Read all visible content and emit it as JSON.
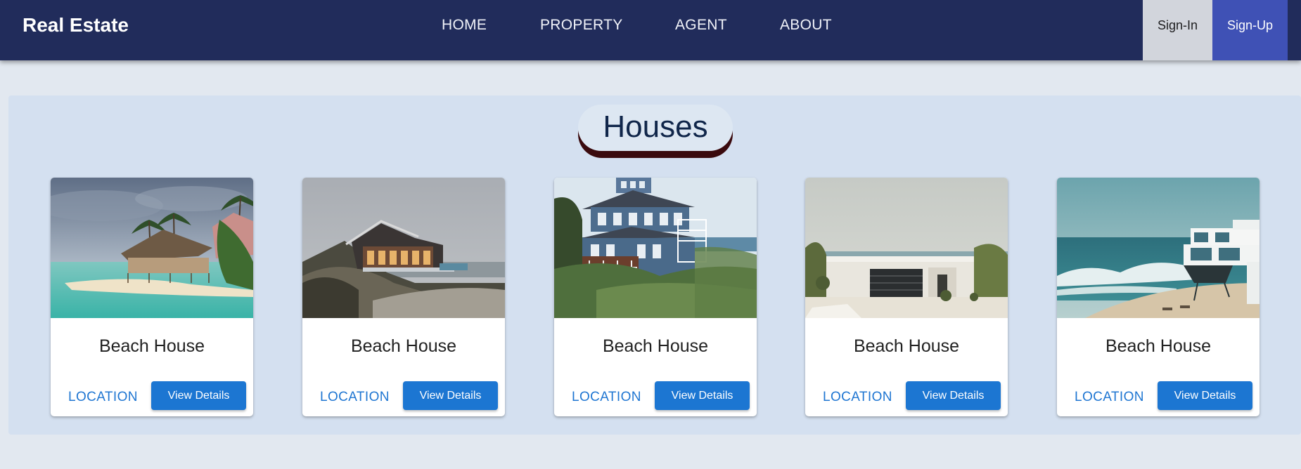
{
  "header": {
    "brand": "Real Estate",
    "nav": [
      "HOME",
      "PROPERTY",
      "AGENT",
      "ABOUT"
    ],
    "sign_in": "Sign-In",
    "sign_up": "Sign-Up"
  },
  "section": {
    "title": "Houses"
  },
  "cards": [
    {
      "title": "Beach House",
      "location": "LOCATION",
      "button": "View Details",
      "image": "tropical-beach-hut-photo"
    },
    {
      "title": "Beach House",
      "location": "LOCATION",
      "button": "View Details",
      "image": "dune-beach-house-dusk-photo"
    },
    {
      "title": "Beach House",
      "location": "LOCATION",
      "button": "View Details",
      "image": "blue-victorian-beach-house-photo"
    },
    {
      "title": "Beach House",
      "location": "LOCATION",
      "button": "View Details",
      "image": "white-modern-beach-house-photo"
    },
    {
      "title": "Beach House",
      "location": "LOCATION",
      "button": "View Details",
      "image": "oceanfront-villa-waves-photo"
    }
  ],
  "colors": {
    "header_bg": "#212c5b",
    "signin_bg": "#d2d5dc",
    "signup_bg": "#3f51b5",
    "section_bg": "#d4e0f0",
    "button_bg": "#1c76d2",
    "link_color": "#1f76d2"
  }
}
